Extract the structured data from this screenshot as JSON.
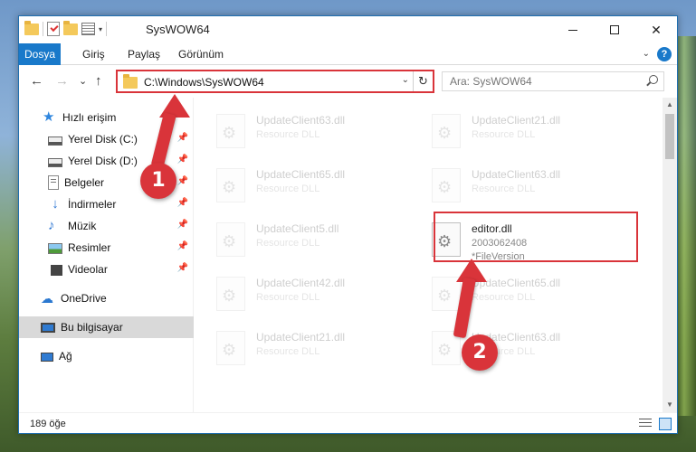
{
  "window": {
    "title": "SysWOW64",
    "minimize": "",
    "maximize": "",
    "close": "✕"
  },
  "ribbon": {
    "tabs": [
      "Dosya",
      "Giriş",
      "Paylaş",
      "Görünüm"
    ],
    "help": "?"
  },
  "nav": {
    "back": "←",
    "forward": "→",
    "recent": "⌄",
    "up": "↑",
    "address": "C:\\Windows\\SysWOW64",
    "search_placeholder": "Ara: SysWOW64"
  },
  "sidebar": {
    "items": [
      {
        "label": "Hızlı erişim",
        "icon": "star-icon",
        "pinned": false
      },
      {
        "label": "Yerel Disk (C:)",
        "icon": "drive-icon",
        "pinned": true
      },
      {
        "label": "Yerel Disk (D:)",
        "icon": "drive-icon",
        "pinned": true
      },
      {
        "label": "Belgeler",
        "icon": "documents-icon",
        "pinned": true
      },
      {
        "label": "İndirmeler",
        "icon": "downloads-icon",
        "pinned": true
      },
      {
        "label": "Müzik",
        "icon": "music-icon",
        "pinned": true
      },
      {
        "label": "Resimler",
        "icon": "pictures-icon",
        "pinned": true
      },
      {
        "label": "Videolar",
        "icon": "videos-icon",
        "pinned": true
      },
      {
        "label": "OneDrive",
        "icon": "onedrive-icon",
        "pinned": false
      },
      {
        "label": "Bu bilgisayar",
        "icon": "this-pc-icon",
        "pinned": false,
        "selected": true
      },
      {
        "label": "Ağ",
        "icon": "network-icon",
        "pinned": false
      }
    ]
  },
  "files": [
    {
      "name": "UpdateClient63.dll",
      "type": "Resource DLL"
    },
    {
      "name": "UpdateClient21.dll",
      "type": "Resource DLL"
    },
    {
      "name": "UpdateClient65.dll",
      "type": "Resource DLL"
    },
    {
      "name": "UpdateClient63.dll",
      "type": "Resource DLL"
    },
    {
      "name": "UpdateClient5.dll",
      "type": "Resource DLL"
    },
    {
      "name": "editor.dll",
      "type": "2003062408",
      "extra": "*FileVersion",
      "highlighted": true
    },
    {
      "name": "UpdateClient42.dll",
      "type": "Resource DLL"
    },
    {
      "name": "UpdateClient65.dll",
      "type": "Resource DLL"
    },
    {
      "name": "UpdateClient21.dll",
      "type": "Resource DLL"
    },
    {
      "name": "UpdateClient63.dll",
      "type": "Resource DLL"
    }
  ],
  "status": {
    "count": "189 öğe"
  },
  "callouts": [
    "1",
    "2"
  ],
  "colors": {
    "accent": "#1979ca",
    "callout": "#d9343a",
    "selected_bg": "#d9d9d9"
  }
}
